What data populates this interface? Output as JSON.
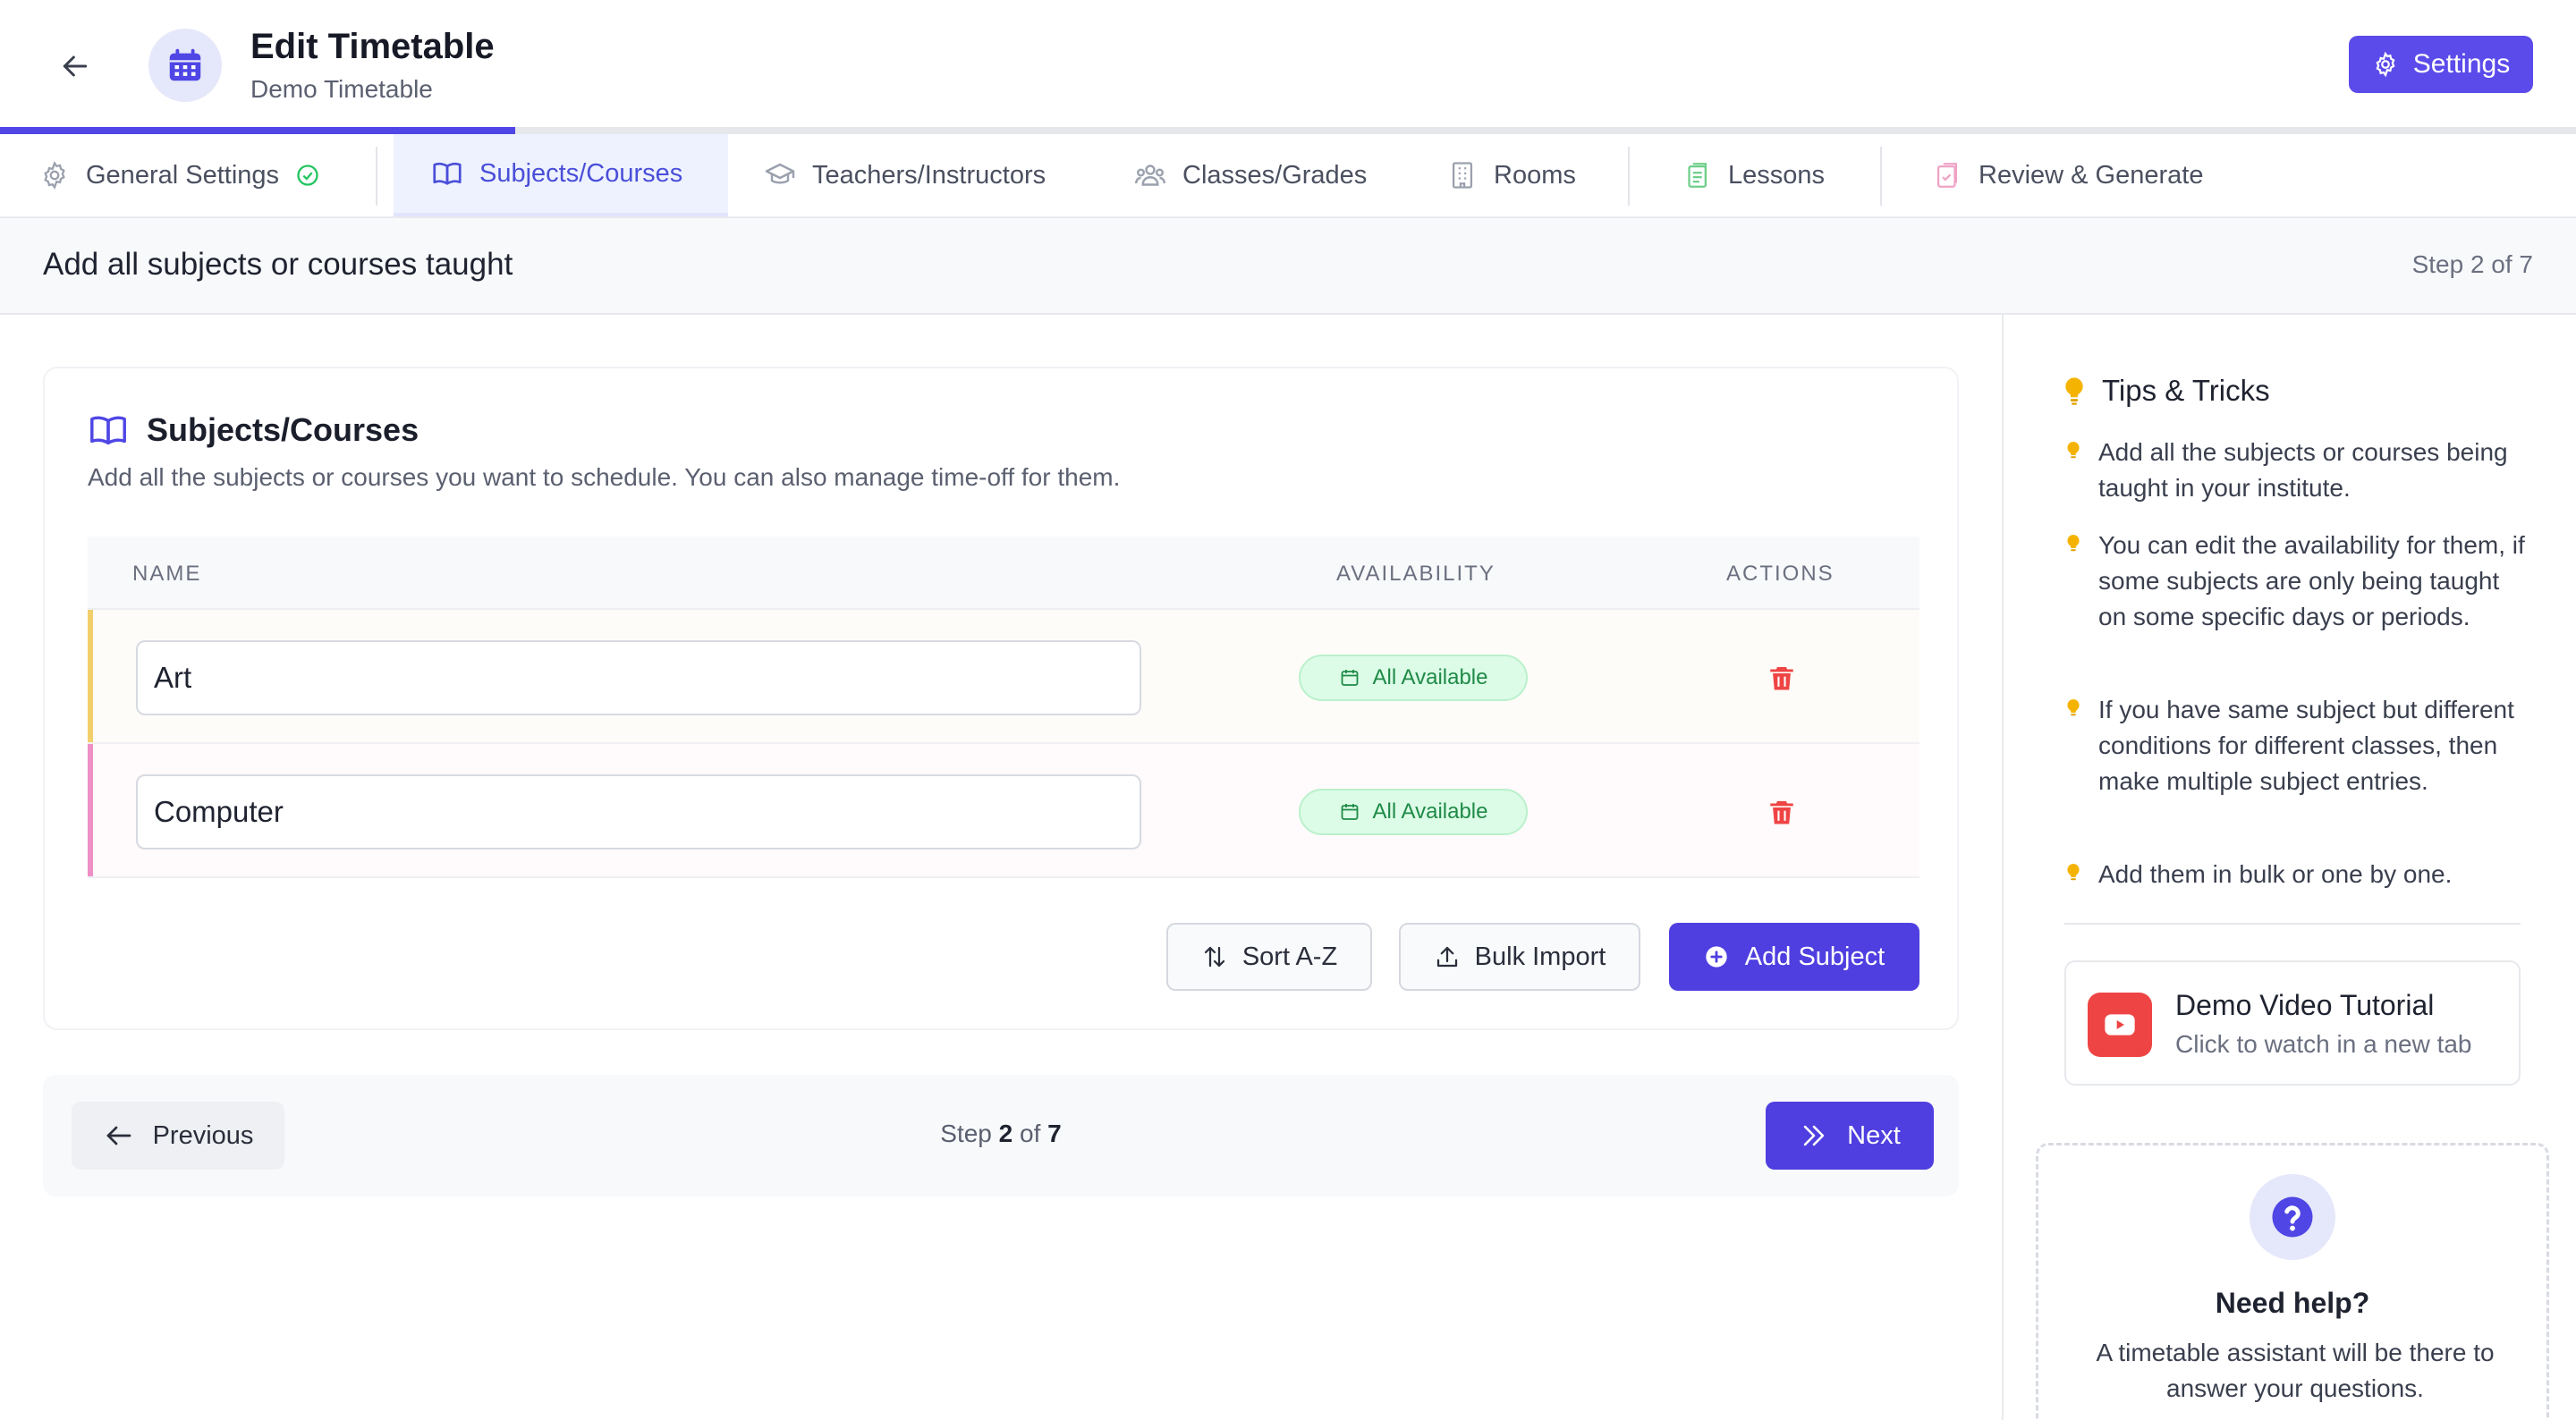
{
  "header": {
    "title": "Edit Timetable",
    "subtitle": "Demo Timetable",
    "settings_label": "Settings",
    "progress_fraction": 0.2
  },
  "tabs": [
    {
      "label": "General Settings",
      "icon": "gear-icon",
      "completed": true
    },
    {
      "label": "Subjects/Courses",
      "icon": "book-icon",
      "active": true
    },
    {
      "label": "Teachers/Instructors",
      "icon": "graduation-cap-icon"
    },
    {
      "label": "Classes/Grades",
      "icon": "users-icon"
    },
    {
      "label": "Rooms",
      "icon": "building-icon"
    },
    {
      "label": "Lessons",
      "icon": "clipboard-icon"
    },
    {
      "label": "Review & Generate",
      "icon": "checklist-icon"
    }
  ],
  "stepbar": {
    "title": "Add all subjects or courses taught",
    "step_text": "Step 2 of 7"
  },
  "panel": {
    "title": "Subjects/Courses",
    "description": "Add all the subjects or courses you want to schedule. You can also manage time-off for them.",
    "columns": {
      "name": "NAME",
      "availability": "AVAILABILITY",
      "actions": "ACTIONS"
    },
    "rows": [
      {
        "name": "Art",
        "availability": "All Available",
        "stripe_color": "#f2cf6b",
        "row_bg": "#fefcf9"
      },
      {
        "name": "Computer",
        "availability": "All Available",
        "stripe_color": "#ee8fc5",
        "row_bg": "#fffafb"
      }
    ],
    "buttons": {
      "sort": "Sort A-Z",
      "bulk_import": "Bulk Import",
      "add": "Add Subject"
    }
  },
  "footer": {
    "previous": "Previous",
    "step_prefix": "Step",
    "step_current": "2",
    "step_of": "of",
    "step_total": "7",
    "next": "Next"
  },
  "sidebar": {
    "tips_title": "Tips & Tricks",
    "tips": [
      "Add all the subjects or courses being taught in your institute.",
      "You can edit the availability for them, if some subjects are only being taught on some specific days or periods.",
      "If you have same subject but different conditions for different classes, then make multiple subject entries.",
      "Add them in bulk or one by one."
    ],
    "video": {
      "title": "Demo Video Tutorial",
      "subtitle": "Click to watch in a new tab"
    },
    "help": {
      "title": "Need help?",
      "description": "A timetable assistant will be there to answer your questions."
    }
  },
  "colors": {
    "accent": "#4f46e5",
    "primary_button": "#4f3fe0",
    "success": "#22c55e",
    "danger": "#ef4444",
    "bulb": "#f5b301"
  }
}
